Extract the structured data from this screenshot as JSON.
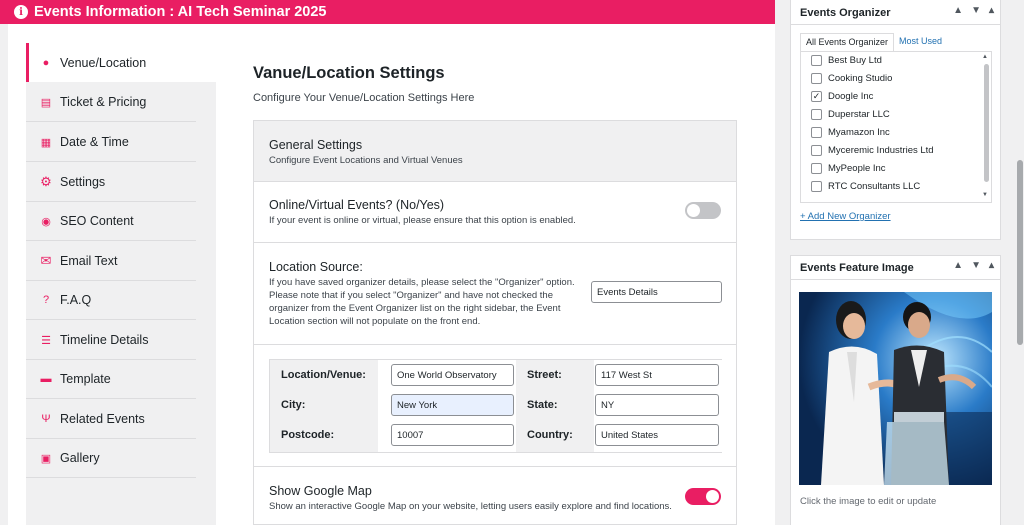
{
  "header": {
    "title": "Events Information : AI Tech Seminar 2025"
  },
  "tabs": [
    {
      "label": "Venue/Location",
      "icon": "map-pin-icon",
      "glyph": "●"
    },
    {
      "label": "Ticket & Pricing",
      "icon": "ticket-icon",
      "glyph": "▤"
    },
    {
      "label": "Date & Time",
      "icon": "calendar-icon",
      "glyph": "▦"
    },
    {
      "label": "Settings",
      "icon": "gears-icon",
      "glyph": "⚙"
    },
    {
      "label": "SEO Content",
      "icon": "search-icon",
      "glyph": "◉"
    },
    {
      "label": "Email Text",
      "icon": "envelope-icon",
      "glyph": "✉"
    },
    {
      "label": "F.A.Q",
      "icon": "question-icon",
      "glyph": "?"
    },
    {
      "label": "Timeline Details",
      "icon": "list-icon",
      "glyph": "☰"
    },
    {
      "label": "Template",
      "icon": "template-icon",
      "glyph": "▬"
    },
    {
      "label": "Related Events",
      "icon": "plug-icon",
      "glyph": "Ψ"
    },
    {
      "label": "Gallery",
      "icon": "image-icon",
      "glyph": "▣"
    }
  ],
  "content": {
    "title": "Vanue/Location Settings",
    "subtitle": "Configure Your Venue/Location Settings Here",
    "general": {
      "title": "General Settings",
      "desc": "Configure Event Locations and Virtual Venues"
    },
    "online": {
      "title": "Online/Virtual Events? (No/Yes)",
      "desc": "If your event is online or virtual, please ensure that this option is enabled.",
      "enabled": false
    },
    "location_source": {
      "title": "Location Source:",
      "desc": "If you have saved organizer details, please select the \"Organizer\" option. Please note that if you select \"Organizer\" and have not checked the organizer from the Event Organizer list on the right sidebar, the Event Location section will not populate on the front end.",
      "value": "Events Details"
    },
    "address": {
      "venue_label": "Location/Venue:",
      "venue": "One World Observatory",
      "street_label": "Street:",
      "street": "117 West St",
      "city_label": "City:",
      "city": "New York",
      "state_label": "State:",
      "state": "NY",
      "postcode_label": "Postcode:",
      "postcode": "10007",
      "country_label": "Country:",
      "country": "United States"
    },
    "map": {
      "title": "Show Google Map",
      "desc": "Show an interactive Google Map on your website, letting users easily explore and find locations.",
      "enabled": true
    }
  },
  "sidebar": {
    "organizer": {
      "title": "Events Organizer",
      "tab_all": "All Events Organizer",
      "tab_used": "Most Used",
      "items": [
        {
          "label": "Best Buy Ltd",
          "checked": false,
          "mark": ""
        },
        {
          "label": "Cooking Studio",
          "checked": false,
          "mark": ""
        },
        {
          "label": "Doogle Inc",
          "checked": true,
          "mark": "✓"
        },
        {
          "label": "Duperstar LLC",
          "checked": false,
          "mark": ""
        },
        {
          "label": "Myamazon Inc",
          "checked": false,
          "mark": ""
        },
        {
          "label": "Myceremic Industries Ltd",
          "checked": false,
          "mark": ""
        },
        {
          "label": "MyPeople Inc",
          "checked": false,
          "mark": ""
        },
        {
          "label": "RTC Consultants LLC",
          "checked": false,
          "mark": ""
        }
      ],
      "add_link": "+ Add New Organizer"
    },
    "feature": {
      "title": "Events Feature Image",
      "caption": "Click the image to edit or update"
    }
  },
  "colors": {
    "accent": "#e91e63",
    "link": "#2271b1"
  }
}
